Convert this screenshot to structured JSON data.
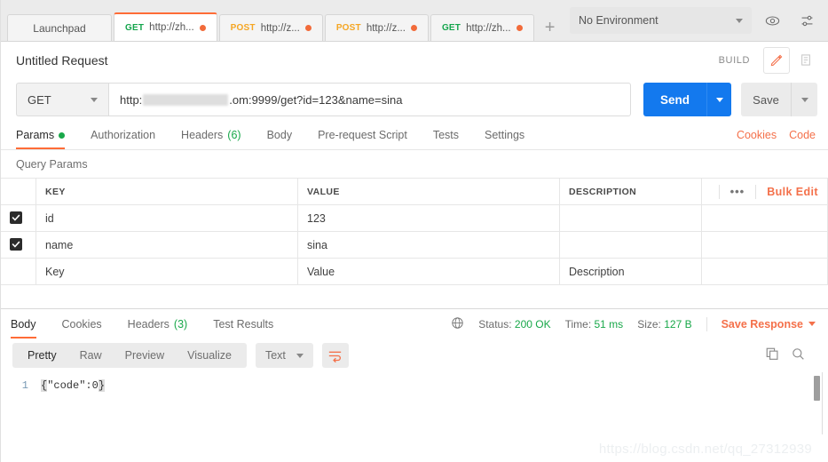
{
  "tabbar": {
    "launchpad_label": "Launchpad",
    "tabs": [
      {
        "method": "GET",
        "url": "http://zh...",
        "active": true
      },
      {
        "method": "POST",
        "url": "http://z...",
        "active": false
      },
      {
        "method": "POST",
        "url": "http://z...",
        "active": false
      },
      {
        "method": "GET",
        "url": "http://zh...",
        "active": false
      }
    ],
    "add_label": "+",
    "more_label": "●●●",
    "environment": "No Environment",
    "eye_icon": "eye-icon",
    "settings_icon": "sliders-icon"
  },
  "title_row": {
    "request_title": "Untitled Request",
    "build_label": "BUILD",
    "edit_icon": "pencil-icon",
    "docs_icon": "document-icon"
  },
  "urlbar": {
    "method": "GET",
    "url_prefix": "http:",
    "url_suffix": ".om:9999/get?id=123&name=sina",
    "send_label": "Send",
    "save_label": "Save"
  },
  "request_tabs": {
    "items": [
      {
        "label": "Params",
        "badge": "",
        "dot": true,
        "active": true
      },
      {
        "label": "Authorization",
        "badge": "",
        "dot": false,
        "active": false
      },
      {
        "label": "Headers",
        "badge": "(6)",
        "dot": false,
        "active": false
      },
      {
        "label": "Body",
        "badge": "",
        "dot": false,
        "active": false
      },
      {
        "label": "Pre-request Script",
        "badge": "",
        "dot": false,
        "active": false
      },
      {
        "label": "Tests",
        "badge": "",
        "dot": false,
        "active": false
      },
      {
        "label": "Settings",
        "badge": "",
        "dot": false,
        "active": false
      }
    ],
    "cookies_label": "Cookies",
    "code_label": "Code"
  },
  "query_params": {
    "section_title": "Query Params",
    "headers": {
      "key": "KEY",
      "value": "VALUE",
      "description": "DESCRIPTION"
    },
    "dots_label": "•••",
    "bulk_edit_label": "Bulk Edit",
    "rows": [
      {
        "checked": true,
        "key": "id",
        "value": "123",
        "description": ""
      },
      {
        "checked": true,
        "key": "name",
        "value": "sina",
        "description": ""
      }
    ],
    "placeholder_row": {
      "key": "Key",
      "value": "Value",
      "description": "Description"
    }
  },
  "response": {
    "tabs": [
      {
        "label": "Body",
        "badge": "",
        "active": true
      },
      {
        "label": "Cookies",
        "badge": "",
        "active": false
      },
      {
        "label": "Headers",
        "badge": "(3)",
        "active": false
      },
      {
        "label": "Test Results",
        "badge": "",
        "active": false
      }
    ],
    "globe_icon": "globe-icon",
    "status_label": "Status:",
    "status_value": "200 OK",
    "time_label": "Time:",
    "time_value": "51 ms",
    "size_label": "Size:",
    "size_value": "127 B",
    "save_response_label": "Save Response",
    "view_modes": [
      {
        "label": "Pretty",
        "active": true
      },
      {
        "label": "Raw",
        "active": false
      },
      {
        "label": "Preview",
        "active": false
      },
      {
        "label": "Visualize",
        "active": false
      }
    ],
    "format": "Text",
    "wrap_icon": "word-wrap-icon",
    "copy_icon": "copy-icon",
    "search_icon": "search-icon",
    "body": {
      "line_number": "1",
      "open_brace": "{",
      "content": "\"code\":0",
      "close_brace": "}"
    }
  },
  "watermark": "https://blog.csdn.net/qq_27312939",
  "colors": {
    "accent_orange": "#ff6c37",
    "link_orange": "#f4704a",
    "send_blue": "#1379ee",
    "success_green": "#19a84a",
    "method_get": "#14a54c",
    "method_post": "#f5a623",
    "tab_dot": "#f26b3a"
  }
}
